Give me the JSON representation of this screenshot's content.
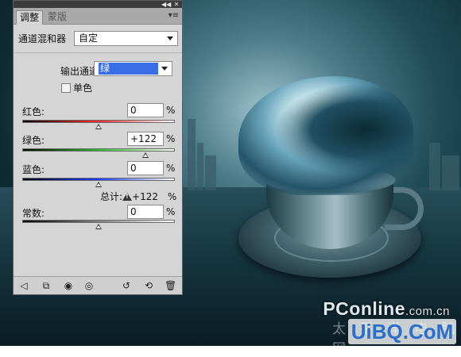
{
  "panel": {
    "collapse_glyph": "◀◀",
    "close_glyph": "✕",
    "menu_glyph": "▾≡",
    "tabs": [
      {
        "label": "调整",
        "active": true
      },
      {
        "label": "蒙版",
        "active": false
      }
    ],
    "adjustment_name": "通道混和器",
    "preset_value": "自定",
    "output_channel_label": "输出通道:",
    "output_channel_value": "绿",
    "monochrome_label": "单色",
    "monochrome_checked": false,
    "sliders": [
      {
        "label": "红色:",
        "value": "0",
        "unit": "%",
        "level_percent": 0,
        "track_gradient": [
          "#000000",
          "#ff2b2b",
          "#ffffff"
        ]
      },
      {
        "label": "绿色:",
        "value": "+122",
        "unit": "%",
        "level_percent": 122,
        "track_gradient": [
          "#000000",
          "#29c229",
          "#ffffff"
        ]
      },
      {
        "label": "蓝色:",
        "value": "0",
        "unit": "%",
        "level_percent": 0,
        "track_gradient": [
          "#000000",
          "#1d3cff",
          "#ffffff"
        ]
      }
    ],
    "total_label": "总计:",
    "total_value": "+122",
    "total_unit": "%",
    "constant": {
      "label": "常数:",
      "value": "0",
      "unit": "%",
      "level_percent": 0,
      "track_gradient": [
        "#000000",
        "#808080",
        "#ffffff"
      ]
    },
    "bottom_icons": [
      "back-arrow-icon",
      "expand-view-icon",
      "clip-layer-icon",
      "visibility-eye-icon",
      "view-previous-icon",
      "reset-icon",
      "trash-icon"
    ]
  },
  "watermark": {
    "brand": "PConline",
    "domain_suffix": ".com.cn",
    "cn_text": "太 平 洋 电 脑 网",
    "site": "UiBQ.CoM"
  }
}
